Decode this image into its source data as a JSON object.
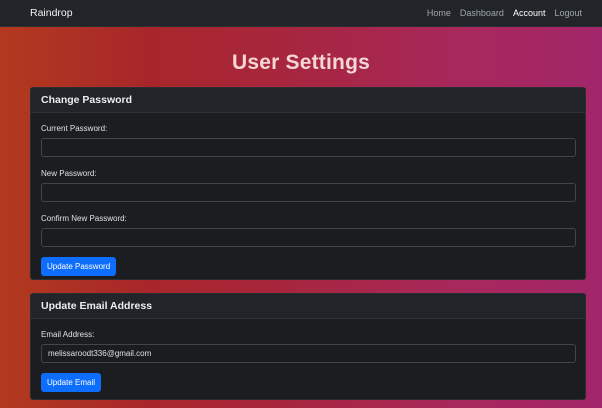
{
  "navbar": {
    "brand": "Raindrop",
    "links": [
      "Home",
      "Dashboard",
      "Account",
      "Logout"
    ]
  },
  "page": {
    "title": "User Settings"
  },
  "change_password": {
    "header": "Change Password",
    "current_label": "Current Password:",
    "current_value": "",
    "new_label": "New Password:",
    "new_value": "",
    "confirm_label": "Confirm New Password:",
    "confirm_value": "",
    "button": "Update Password"
  },
  "update_email": {
    "header": "Update Email Address",
    "email_label": "Email Address:",
    "email_value": "melissaroodt336@gmail.com",
    "button": "Update Email"
  },
  "colors": {
    "navbar_bg": "#212529",
    "card_bg": "#1b1d20",
    "button_primary": "#0d6efd",
    "title_text": "#f4d6d4"
  }
}
